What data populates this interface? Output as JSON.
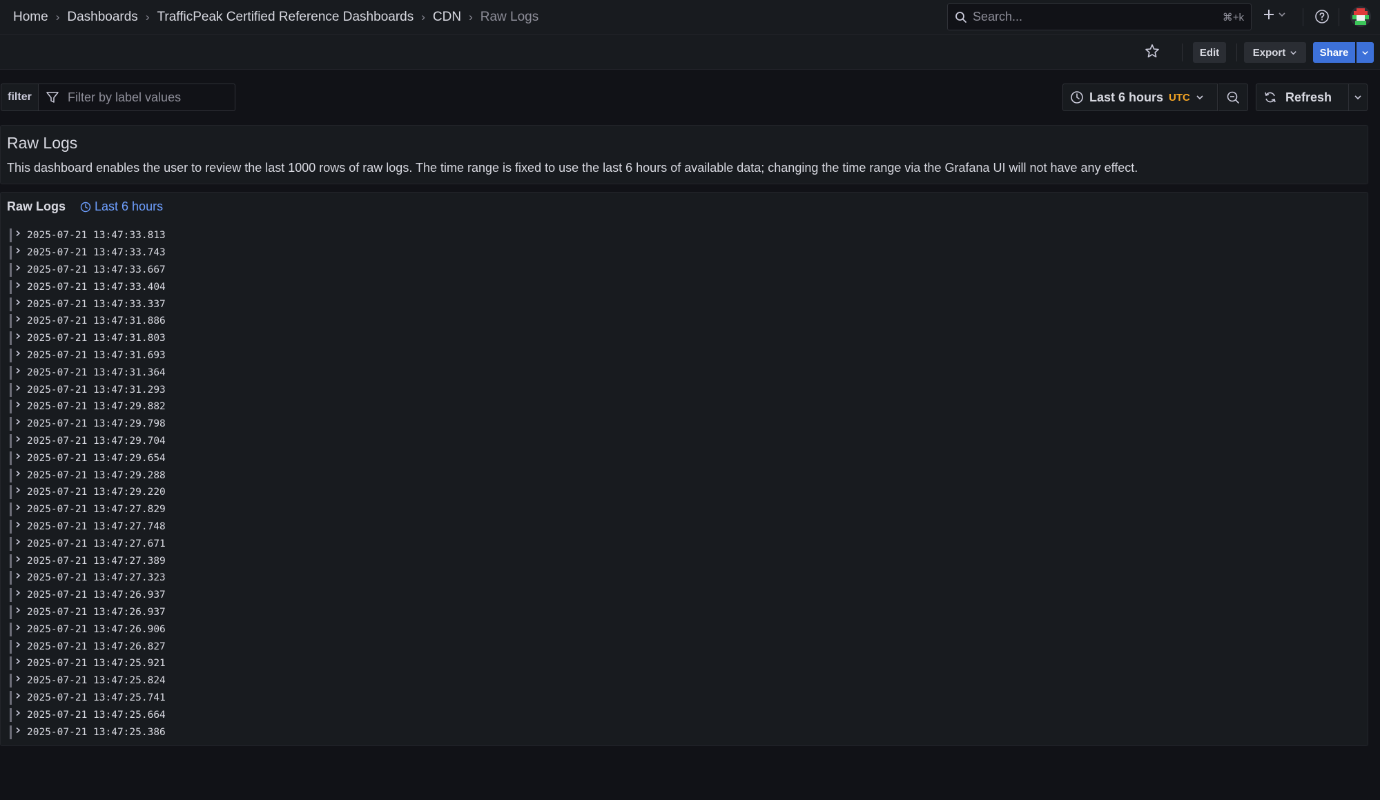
{
  "breadcrumb": [
    "Home",
    "Dashboards",
    "TrafficPeak Certified Reference Dashboards",
    "CDN",
    "Raw Logs"
  ],
  "search": {
    "placeholder": "Search...",
    "shortcut": "⌘+k"
  },
  "toolbar": {
    "edit_label": "Edit",
    "export_label": "Export",
    "share_label": "Share"
  },
  "filter": {
    "label": "filter",
    "placeholder": "Filter by label values"
  },
  "time_picker": {
    "range": "Last 6 hours",
    "timezone": "UTC"
  },
  "refresh": {
    "label": "Refresh"
  },
  "text_panel": {
    "title": "Raw Logs",
    "body": "This dashboard enables the user to review the last 1000 rows of raw logs. The time range is fixed to use the last 6 hours of available data; changing the time range via the Grafana UI will not have any effect."
  },
  "logs_panel": {
    "title": "Raw Logs",
    "time_override": "Last 6 hours",
    "rows": [
      "2025-07-21 13:47:33.813",
      "2025-07-21 13:47:33.743",
      "2025-07-21 13:47:33.667",
      "2025-07-21 13:47:33.404",
      "2025-07-21 13:47:33.337",
      "2025-07-21 13:47:31.886",
      "2025-07-21 13:47:31.803",
      "2025-07-21 13:47:31.693",
      "2025-07-21 13:47:31.364",
      "2025-07-21 13:47:31.293",
      "2025-07-21 13:47:29.882",
      "2025-07-21 13:47:29.798",
      "2025-07-21 13:47:29.704",
      "2025-07-21 13:47:29.654",
      "2025-07-21 13:47:29.288",
      "2025-07-21 13:47:29.220",
      "2025-07-21 13:47:27.829",
      "2025-07-21 13:47:27.748",
      "2025-07-21 13:47:27.671",
      "2025-07-21 13:47:27.389",
      "2025-07-21 13:47:27.323",
      "2025-07-21 13:47:26.937",
      "2025-07-21 13:47:26.937",
      "2025-07-21 13:47:26.906",
      "2025-07-21 13:47:26.827",
      "2025-07-21 13:47:25.921",
      "2025-07-21 13:47:25.824",
      "2025-07-21 13:47:25.741",
      "2025-07-21 13:47:25.664",
      "2025-07-21 13:47:25.386"
    ]
  },
  "colors": {
    "accent": "#3d71d9",
    "timezone": "#f5a524",
    "link": "#6e9fff",
    "background": "#111217",
    "panel": "#181b1f"
  }
}
